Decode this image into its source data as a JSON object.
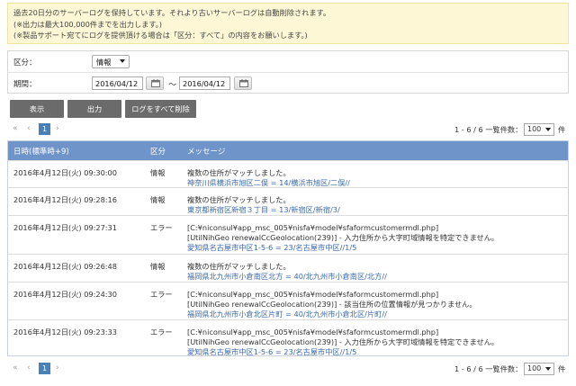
{
  "notice": {
    "line1": "過去20日分のサーバーログを保持しています。それより古いサーバーログは自動削除されます。",
    "line2": "(※出力は最大100,000件までを出力します。)",
    "line3": "(※製品サポート宛てにログを提供頂ける場合は「区分：すべて」の内容をお願いします。)"
  },
  "filter": {
    "category_label": "区分：",
    "category_value": "情報",
    "period_label": "期間：",
    "date_from": "2016/04/12",
    "date_to": "2016/04/12",
    "tilde": "～"
  },
  "buttons": {
    "show": "表示",
    "export": "出力",
    "delete_all": "ログをすべて削除"
  },
  "pager": {
    "first": "«",
    "prev": "‹",
    "current_page": "1",
    "next": "›",
    "range_text": "1 - 6 / 6 一覧件数：",
    "per_page": "100",
    "unit": "件"
  },
  "table": {
    "headers": [
      "日時(標準時+9)",
      "区分",
      "メッセージ"
    ],
    "rows": [
      {
        "date": "2016年4月12日(火) 09:30:00",
        "type": "情報",
        "msg_black": [
          "複数の住所がマッチしました。"
        ],
        "msg_blue": [
          "神奈川県横浜市旭区二俣 = 14/横浜市旭区/二俣//"
        ]
      },
      {
        "date": "2016年4月12日(火) 09:28:16",
        "type": "情報",
        "msg_black": [
          "複数の住所がマッチしました。"
        ],
        "msg_blue": [
          "東京都新宿区新宿３丁目 = 13/新宿区/新宿/3/"
        ]
      },
      {
        "date": "2016年4月12日(火) 09:27:31",
        "type": "エラー",
        "msg_black": [
          "[C:¥niconsul¥app_msc_005¥nisfa¥model¥sfaformcustomermdl.php]",
          "[UtilNihGeo renewalCcGeolocation(239)] - 入力住所から大字町域情報を特定できません。"
        ],
        "msg_blue": [
          "愛知県名古屋市中区1-5-6 = 23/名古屋市中区//1/5"
        ]
      },
      {
        "date": "2016年4月12日(火) 09:26:48",
        "type": "情報",
        "msg_black": [
          "複数の住所がマッチしました。"
        ],
        "msg_blue": [
          "福岡県北九州市小倉南区北方 = 40/北九州市小倉南区/北方//"
        ]
      },
      {
        "date": "2016年4月12日(火) 09:24:30",
        "type": "エラー",
        "msg_black": [
          "[C:¥niconsul¥app_msc_005¥nisfa¥model¥sfaformcustomermdl.php]",
          "[UtilNihGeo renewalCcGeolocation(239)] - 該当住所の位置情報が見つかりません。"
        ],
        "msg_blue": [
          "福岡県北九州市小倉北区片町 = 40/北九州市小倉北区/片町//"
        ]
      },
      {
        "date": "2016年4月12日(火) 09:23:33",
        "type": "エラー",
        "msg_black": [
          "[C:¥niconsul¥app_msc_005¥nisfa¥model¥sfaformcustomermdl.php]",
          "[UtilNihGeo renewalCcGeolocation(239)] - 入力住所から大字町域情報を特定できません。"
        ],
        "msg_blue": [
          "愛知県名古屋市中区1-5-6 = 23/名古屋市中区//1/5"
        ]
      }
    ]
  }
}
